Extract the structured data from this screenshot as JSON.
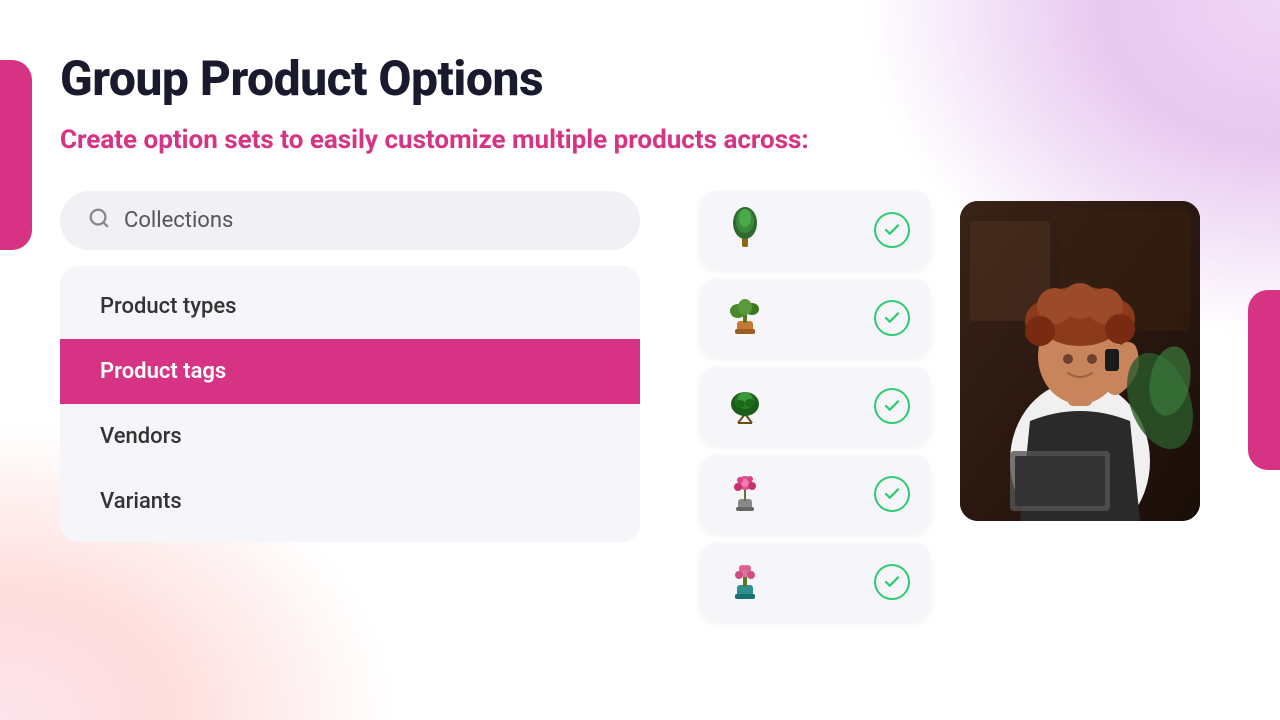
{
  "page": {
    "title": "Group Product Options",
    "subtitle": "Create option sets to easily customize multiple products across:"
  },
  "search": {
    "placeholder": "Collections"
  },
  "menu": {
    "items": [
      {
        "id": "product-types",
        "label": "Product types",
        "active": false
      },
      {
        "id": "product-tags",
        "label": "Product tags",
        "active": true
      },
      {
        "id": "vendors",
        "label": "Vendors",
        "active": false
      },
      {
        "id": "variants",
        "label": "Variants",
        "active": false
      }
    ]
  },
  "products": [
    {
      "id": 1,
      "emoji": "🌿",
      "checked": true
    },
    {
      "id": 2,
      "emoji": "🪴",
      "checked": true
    },
    {
      "id": 3,
      "emoji": "🌱",
      "checked": true
    },
    {
      "id": 4,
      "emoji": "🌸",
      "checked": true
    },
    {
      "id": 5,
      "emoji": "🌺",
      "checked": true
    }
  ],
  "icons": {
    "search": "🔍",
    "check": "✓"
  },
  "colors": {
    "accent": "#d63384",
    "green": "#2ecc71",
    "bg_card": "#f5f5fa",
    "title": "#1a1a2e"
  }
}
